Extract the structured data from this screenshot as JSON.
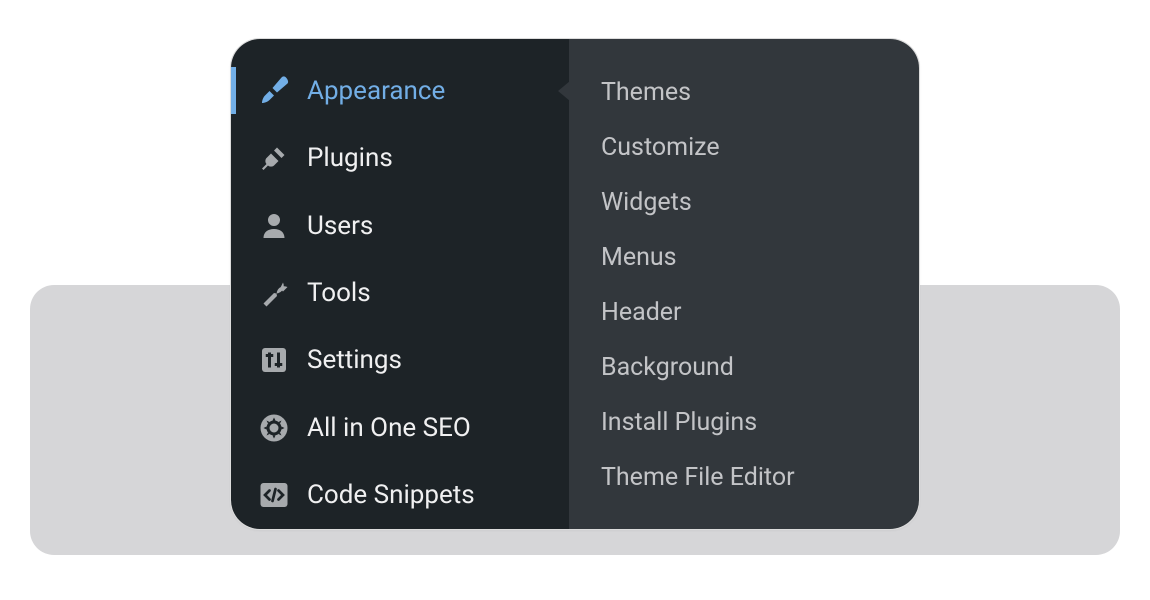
{
  "sidebar": {
    "items": [
      {
        "id": "appearance",
        "label": "Appearance",
        "icon": "brush-icon",
        "active": true
      },
      {
        "id": "plugins",
        "label": "Plugins",
        "icon": "plug-icon",
        "active": false
      },
      {
        "id": "users",
        "label": "Users",
        "icon": "user-icon",
        "active": false
      },
      {
        "id": "tools",
        "label": "Tools",
        "icon": "wrench-icon",
        "active": false
      },
      {
        "id": "settings",
        "label": "Settings",
        "icon": "sliders-icon",
        "active": false
      },
      {
        "id": "all-in-one-seo",
        "label": "All in One SEO",
        "icon": "gear-icon",
        "active": false
      },
      {
        "id": "code-snippets",
        "label": "Code Snippets",
        "icon": "code-icon",
        "active": false
      }
    ]
  },
  "submenu": {
    "items": [
      {
        "id": "themes",
        "label": "Themes"
      },
      {
        "id": "customize",
        "label": "Customize"
      },
      {
        "id": "widgets",
        "label": "Widgets"
      },
      {
        "id": "menus",
        "label": "Menus"
      },
      {
        "id": "header",
        "label": "Header"
      },
      {
        "id": "background",
        "label": "Background"
      },
      {
        "id": "install-plugins",
        "label": "Install Plugins"
      },
      {
        "id": "theme-file-editor",
        "label": "Theme File Editor"
      }
    ]
  },
  "colors": {
    "sidebar_bg": "#1d2327",
    "submenu_bg": "#32373c",
    "active": "#72aee6",
    "text": "#f0f0f1",
    "sub_text": "#c3c4c7"
  }
}
